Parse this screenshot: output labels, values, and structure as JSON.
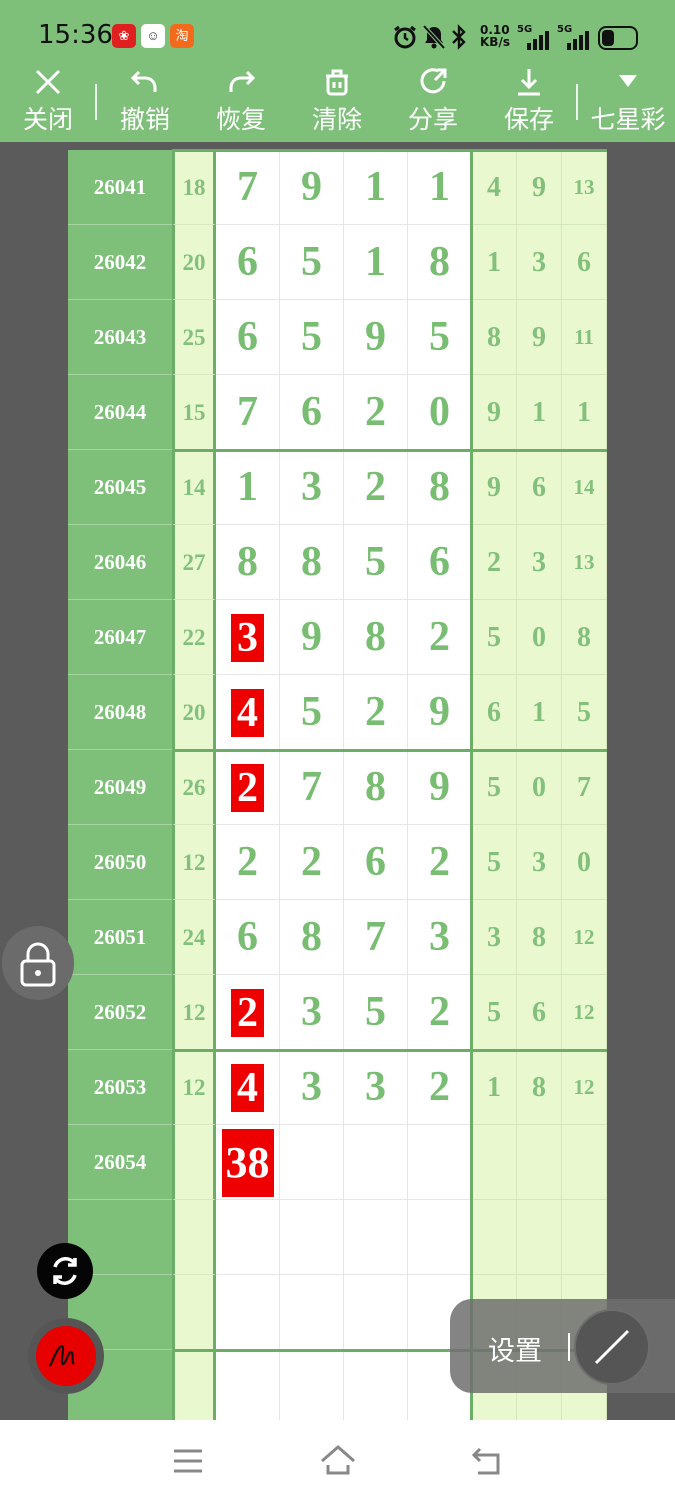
{
  "status_bar": {
    "time": "15:36",
    "net_speed_value": "0.10",
    "net_speed_unit": "KB/s",
    "signal_1_label": "5G",
    "signal_2_label": "5G",
    "taobao_badge": "淘",
    "icons": [
      "huawei-app-icon",
      "avatar-app-icon",
      "taobao-app-icon",
      "alarm-icon",
      "mute-bell-icon",
      "bluetooth-icon",
      "signal-icon",
      "battery-icon"
    ]
  },
  "toolbar": {
    "close": "关闭",
    "undo": "撤销",
    "redo": "恢复",
    "clear": "清除",
    "share": "分享",
    "save": "保存",
    "lottery": "七星彩"
  },
  "rows": [
    {
      "id": "26041",
      "sum": "18",
      "digits": [
        "7",
        "9",
        "1",
        "1"
      ],
      "hl": [],
      "right": [
        "4",
        "9",
        "13"
      ]
    },
    {
      "id": "26042",
      "sum": "20",
      "digits": [
        "6",
        "5",
        "1",
        "8"
      ],
      "hl": [],
      "right": [
        "1",
        "3",
        "6"
      ]
    },
    {
      "id": "26043",
      "sum": "25",
      "digits": [
        "6",
        "5",
        "9",
        "5"
      ],
      "hl": [],
      "right": [
        "8",
        "9",
        "11"
      ]
    },
    {
      "id": "26044",
      "sum": "15",
      "digits": [
        "7",
        "6",
        "2",
        "0"
      ],
      "hl": [],
      "right": [
        "9",
        "1",
        "1"
      ]
    },
    {
      "id": "26045",
      "sum": "14",
      "digits": [
        "1",
        "3",
        "2",
        "8"
      ],
      "hl": [],
      "right": [
        "9",
        "6",
        "14"
      ]
    },
    {
      "id": "26046",
      "sum": "27",
      "digits": [
        "8",
        "8",
        "5",
        "6"
      ],
      "hl": [],
      "right": [
        "2",
        "3",
        "13"
      ]
    },
    {
      "id": "26047",
      "sum": "22",
      "digits": [
        "3",
        "9",
        "8",
        "2"
      ],
      "hl": [
        0
      ],
      "right": [
        "5",
        "0",
        "8"
      ]
    },
    {
      "id": "26048",
      "sum": "20",
      "digits": [
        "4",
        "5",
        "2",
        "9"
      ],
      "hl": [
        0
      ],
      "right": [
        "6",
        "1",
        "5"
      ]
    },
    {
      "id": "26049",
      "sum": "26",
      "digits": [
        "2",
        "7",
        "8",
        "9"
      ],
      "hl": [
        0
      ],
      "right": [
        "5",
        "0",
        "7"
      ]
    },
    {
      "id": "26050",
      "sum": "12",
      "digits": [
        "2",
        "2",
        "6",
        "2"
      ],
      "hl": [],
      "right": [
        "5",
        "3",
        "0"
      ]
    },
    {
      "id": "26051",
      "sum": "24",
      "digits": [
        "6",
        "8",
        "7",
        "3"
      ],
      "hl": [],
      "right": [
        "3",
        "8",
        "12"
      ]
    },
    {
      "id": "26052",
      "sum": "12",
      "digits": [
        "2",
        "3",
        "5",
        "2"
      ],
      "hl": [
        0
      ],
      "right": [
        "5",
        "6",
        "12"
      ]
    },
    {
      "id": "26053",
      "sum": "12",
      "digits": [
        "4",
        "3",
        "3",
        "2"
      ],
      "hl": [
        0
      ],
      "right": [
        "1",
        "8",
        "12"
      ]
    },
    {
      "id": "26054",
      "sum": "",
      "digits": [
        "38",
        "",
        "",
        ""
      ],
      "hl": [
        0
      ],
      "right": [
        "",
        "",
        ""
      ]
    },
    {
      "id": "",
      "sum": "",
      "digits": [
        "",
        "",
        "",
        ""
      ],
      "hl": [],
      "right": [
        "",
        "",
        ""
      ]
    },
    {
      "id": "",
      "sum": "",
      "digits": [
        "",
        "",
        "",
        ""
      ],
      "hl": [],
      "right": [
        "",
        "",
        ""
      ]
    },
    {
      "id": "",
      "sum": "",
      "digits": [
        "",
        "",
        "",
        ""
      ],
      "hl": [],
      "right": [
        "",
        "",
        ""
      ]
    }
  ],
  "floating": {
    "settings_label": "设置"
  },
  "colors": {
    "brand_green": "#7ec07a",
    "light_green": "#eaf8cf",
    "digit_green": "#78bd72",
    "highlight_red": "#ee0000",
    "background_gray": "#5b5b5b"
  }
}
